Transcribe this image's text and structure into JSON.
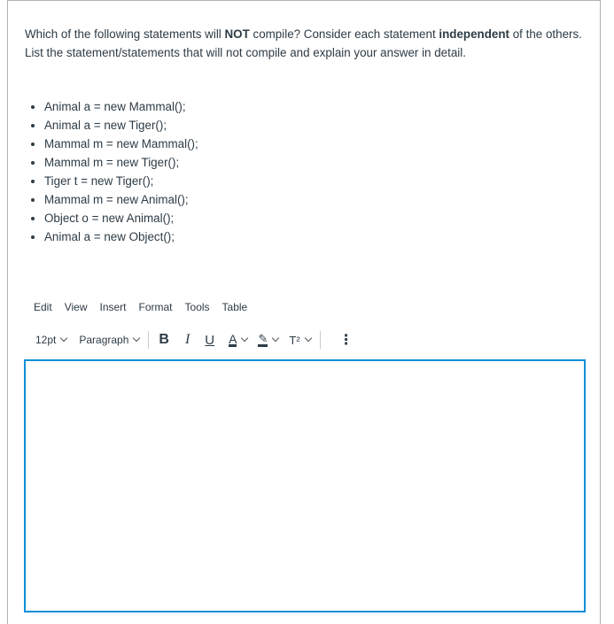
{
  "question": {
    "part1": "Which of the following statements will ",
    "bold1": "NOT",
    "part2": " compile? Consider each statement ",
    "bold2": "independent",
    "part3": " of the others. List the statement/statements that will not compile and explain your answer in detail."
  },
  "statements": [
    "Animal a = new Mammal();",
    "Animal a = new Tiger();",
    "Mammal m = new Mammal();",
    "Mammal m = new Tiger();",
    "Tiger t = new Tiger();",
    "Mammal m = new Animal();",
    "Object o = new Animal();",
    "Animal a = new Object();"
  ],
  "menubar": [
    "Edit",
    "View",
    "Insert",
    "Format",
    "Tools",
    "Table"
  ],
  "toolbar": {
    "font_size": "12pt",
    "block_format": "Paragraph",
    "bold": "B",
    "italic": "I",
    "underline": "U",
    "font_color": "A",
    "highlight": "✎",
    "superscript": "T²",
    "more": "⋮"
  },
  "editor": {
    "value": ""
  },
  "colors": {
    "accent": "#0b8fd9",
    "text": "#2d3b45"
  }
}
